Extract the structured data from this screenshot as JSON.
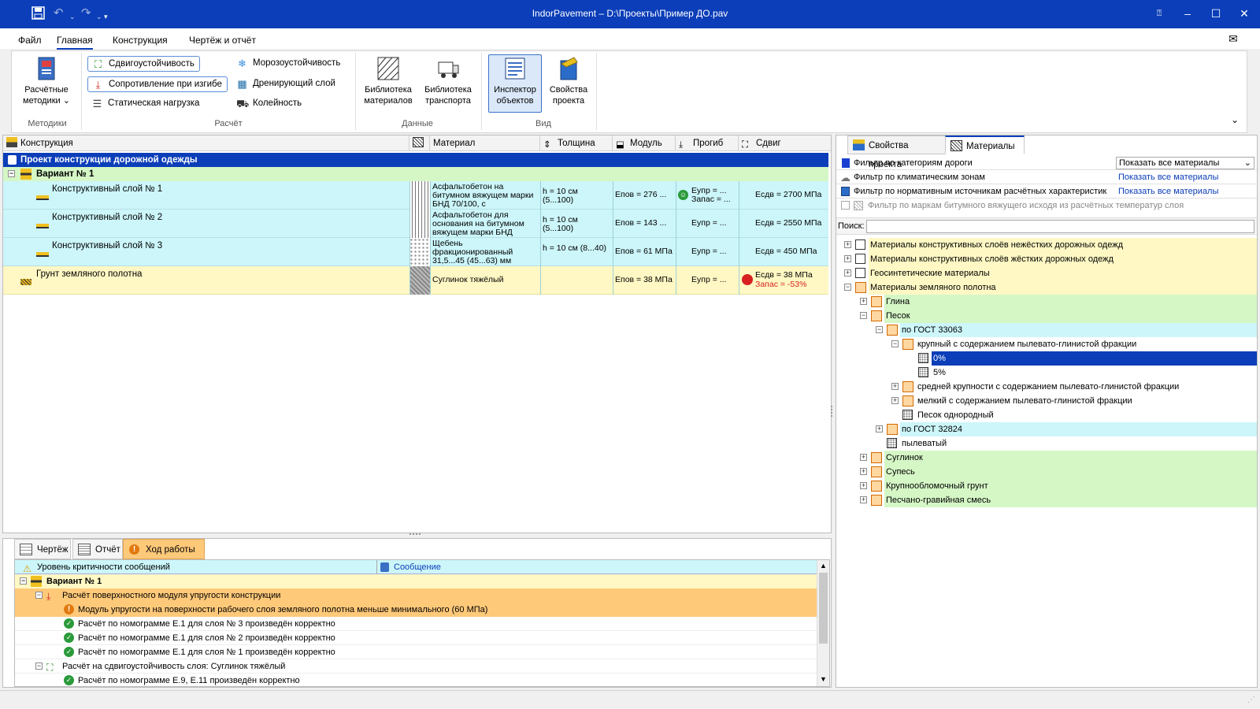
{
  "window": {
    "title": "IndorPavement – D:\\Проекты\\Пример ДО.pav"
  },
  "menu": [
    "Файл",
    "Главная",
    "Конструкция",
    "Чертёж и отчёт"
  ],
  "ribbon": {
    "methods": {
      "label": "Расчётные методики",
      "group": "Методики"
    },
    "calc": {
      "shear": "Сдвигоустойчивость",
      "bending": "Сопротивление при изгибе",
      "static": "Статическая нагрузка",
      "frost": "Морозоустойчивость",
      "drain": "Дренирующий слой",
      "rut": "Колейность",
      "group": "Расчёт"
    },
    "data": {
      "materials": "Библиотека материалов",
      "transport": "Библиотека транспорта",
      "group": "Данные"
    },
    "view": {
      "inspector": "Инспектор объектов",
      "props": "Свойства проекта",
      "group": "Вид"
    }
  },
  "grid": {
    "headers": {
      "construction": "Конструкция",
      "material": "Материал",
      "thickness": "Толщина",
      "module": "Модуль",
      "deflection": "Прогиб",
      "shear": "Сдвиг"
    },
    "project": "Проект конструкции дорожной одежды",
    "variant": "Вариант № 1",
    "layers": [
      {
        "name": "Конструктивный слой № 1",
        "material": "Асфальтобетон на битумном вяжущем марки БНД 70/100, с",
        "thickness": "h = 10 см (5...100)",
        "module": "Eпов = 276 ...",
        "deflection": "Eупр = ... Запас = ...",
        "shear": "Eсдв = 2700 МПа"
      },
      {
        "name": "Конструктивный слой № 2",
        "material": "Асфальтобетон для основания на битумном вяжущем марки БНД",
        "thickness": "h = 10 см (5...100)",
        "module": "Eпов = 143 ...",
        "deflection": "Eупр = ...",
        "shear": "Eсдв = 2550 МПа"
      },
      {
        "name": "Конструктивный слой № 3",
        "material": "Щебень фракционированный 31,5...45 (45...63) мм",
        "thickness": "h = 10 см (8...40)",
        "module": "Eпов = 61 МПа",
        "deflection": "Eупр = ...",
        "shear": "Eсдв = 450 МПа"
      }
    ],
    "soil": {
      "name": "Грунт земляного полотна",
      "material": "Суглинок тяжёлый",
      "module": "Eпов = 38 МПа",
      "deflection": "Eупр = ...",
      "shear": "Eсдв = 38 МПа",
      "shear_reserve": "Запас = -53%"
    }
  },
  "right": {
    "tabs": [
      "Свойства проекта",
      "Материалы"
    ],
    "filters": [
      {
        "label": "Фильтр по категориям дороги",
        "value": "Показать все материалы"
      },
      {
        "label": "Фильтр по климатическим зонам",
        "value": "Показать все материалы"
      },
      {
        "label": "Фильтр по нормативным источникам расчётных характеристик",
        "value": "Показать все материалы"
      },
      {
        "label": "Фильтр по маркам битумного вяжущего исходя из расчётных температур слоя",
        "value": ""
      }
    ],
    "search_label": "Поиск:",
    "tree": [
      {
        "t": "Материалы конструктивных слоёв нежёстких дорожных одежд"
      },
      {
        "t": "Материалы конструктивных слоёв жёстких дорожных одежд"
      },
      {
        "t": "Геосинтетические материалы"
      },
      {
        "t": "Материалы земляного полотна"
      },
      {
        "t": "Глина"
      },
      {
        "t": "Песок"
      },
      {
        "t": "по ГОСТ 33063"
      },
      {
        "t": "крупный с содержанием пылевато-глинистой фракции"
      },
      {
        "t": "0%"
      },
      {
        "t": "5%"
      },
      {
        "t": "средней крупности с содержанием пылевато-глинистой фракции"
      },
      {
        "t": "мелкий с содержанием пылевато-глинистой фракции"
      },
      {
        "t": "Песок однородный"
      },
      {
        "t": "по ГОСТ 32824"
      },
      {
        "t": "пылеватый"
      },
      {
        "t": "Суглинок"
      },
      {
        "t": "Супесь"
      },
      {
        "t": "Крупнообломочный грунт"
      },
      {
        "t": "Песчано-гравийная смесь"
      }
    ]
  },
  "bottom": {
    "tabs": [
      "Чертёж",
      "Отчёт",
      "Ход работы"
    ],
    "headers": {
      "level": "Уровень критичности сообщений",
      "message": "Сообщение"
    },
    "rows": [
      "Вариант № 1",
      "Расчёт поверхностного модуля упругости конструкции",
      "Модуль упругости на поверхности рабочего слоя земляного полотна меньше минимального (60 МПа)",
      "Расчёт по номограмме Е.1 для слоя № 3 произведён корректно",
      "Расчёт по номограмме Е.1 для слоя № 2 произведён корректно",
      "Расчёт по номограмме Е.1 для слоя № 1 произведён корректно",
      "Расчёт на сдвигоустойчивость слоя: Суглинок тяжёлый",
      "Расчёт по номограмме Е.9, Е.11 произведён корректно"
    ]
  },
  "colors": {
    "titlebar": "#0b3eb8",
    "cyan": "#ccf6fa",
    "green": "#d5f7c6",
    "yellow": "#fff8c4",
    "orange": "#ffc97a",
    "selected": "#0b3eb8"
  }
}
